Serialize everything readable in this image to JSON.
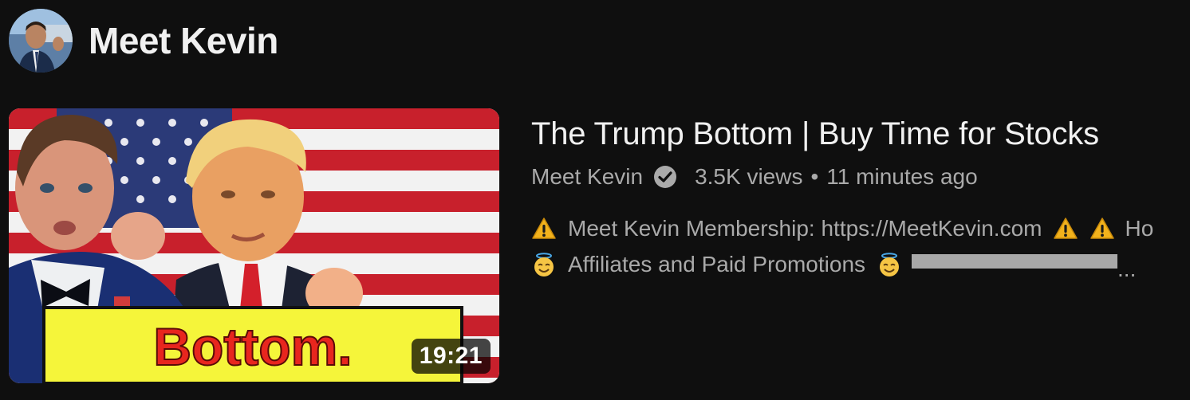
{
  "channel": {
    "name": "Meet Kevin",
    "avatar_icon": "channel-avatar"
  },
  "video": {
    "title": "The Trump Bottom | Buy Time for Stocks",
    "channel_name": "Meet Kevin",
    "verified_icon": "verified-check-icon",
    "views": "3.5K views",
    "separator": "•",
    "uploaded": "11 minutes ago",
    "duration": "19:21",
    "thumbnail_text": "Bottom.",
    "description": {
      "line1_text": "Meet Kevin Membership: https://MeetKevin.com",
      "line1_trailing": "Ho",
      "line2_text": "Affiliates and Paid Promotions",
      "ellipsis": "..."
    }
  },
  "colors": {
    "background": "#0f0f0f",
    "text_primary": "#f1f1f1",
    "text_secondary": "#aaaaaa",
    "thumbnail_banner": "#f5f53a",
    "thumbnail_banner_text": "#e8261e"
  }
}
